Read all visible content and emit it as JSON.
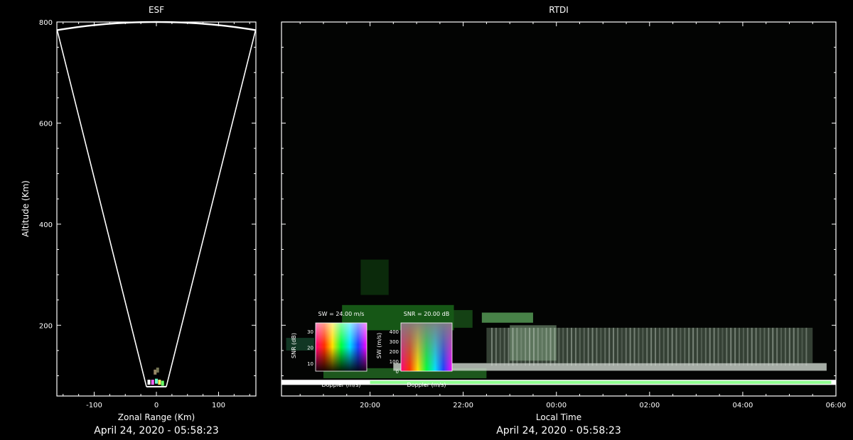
{
  "chart_data": [
    {
      "type": "scatter",
      "title": "ESF",
      "xlabel": "Zonal Range (Km)",
      "ylabel": "Altitude (Km)",
      "footer": "April 24, 2020 - 05:58:23",
      "xlim": [
        -160,
        160
      ],
      "ylim": [
        60,
        800
      ],
      "xticks": [
        -100,
        0,
        100
      ],
      "xtick_labels": [
        "-100",
        "0",
        "100"
      ],
      "yticks": [
        200,
        400,
        600,
        800
      ],
      "ytick_labels": [
        "200",
        "400",
        "600",
        "800"
      ],
      "sector": {
        "half_angle_deg": 11.5,
        "max_range_km": 800,
        "min_range_km": 80
      },
      "echoes": [
        {
          "x": -12,
          "y": 88,
          "color": "#ffffff"
        },
        {
          "x": -6,
          "y": 88,
          "color": "#ff66ff"
        },
        {
          "x": 0,
          "y": 90,
          "color": "#66ffcc"
        },
        {
          "x": 5,
          "y": 88,
          "color": "#ffff66"
        },
        {
          "x": 10,
          "y": 86,
          "color": "#66ff66"
        },
        {
          "x": -2,
          "y": 108,
          "color": "#998866"
        },
        {
          "x": 2,
          "y": 112,
          "color": "#777755"
        }
      ]
    },
    {
      "type": "heatmap",
      "title": "RTDI",
      "xlabel": "Local Time",
      "ylabel": "",
      "footer": "April 24, 2020 - 05:58:23",
      "xlim": [
        18.1,
        30.0
      ],
      "ylim": [
        60,
        800
      ],
      "xticks": [
        20,
        22,
        24,
        26,
        28,
        30
      ],
      "xtick_labels": [
        "20:00",
        "22:00",
        "00:00",
        "02:00",
        "04:00",
        "06:00"
      ],
      "yticks": [
        200,
        400,
        600,
        800
      ],
      "layers": [
        {
          "t0": 18.1,
          "t1": 30.0,
          "y0": 82,
          "y1": 92,
          "color": "#ffffff",
          "alpha": 1.0
        },
        {
          "t0": 20.0,
          "t1": 29.9,
          "y0": 84,
          "y1": 90,
          "color": "#44ff44",
          "alpha": 0.6
        },
        {
          "t0": 19.0,
          "t1": 22.5,
          "y0": 95,
          "y1": 115,
          "color": "#2a7a2a",
          "alpha": 0.7
        },
        {
          "t0": 20.5,
          "t1": 29.8,
          "y0": 110,
          "y1": 125,
          "color": "#cfd8cf",
          "alpha": 0.8
        },
        {
          "t0": 22.5,
          "t1": 29.5,
          "y0": 125,
          "y1": 195,
          "color": "#4a5a4a",
          "alpha": 0.7
        },
        {
          "t0": 23.0,
          "t1": 24.0,
          "y0": 130,
          "y1": 200,
          "color": "#7a9a7a",
          "alpha": 0.6
        },
        {
          "t0": 19.4,
          "t1": 21.8,
          "y0": 190,
          "y1": 240,
          "color": "#1f7a1f",
          "alpha": 0.7
        },
        {
          "t0": 21.8,
          "t1": 22.2,
          "y0": 195,
          "y1": 230,
          "color": "#1f6a1f",
          "alpha": 0.6
        },
        {
          "t0": 22.4,
          "t1": 23.5,
          "y0": 205,
          "y1": 225,
          "color": "#5aa35a",
          "alpha": 0.8
        },
        {
          "t0": 18.2,
          "t1": 18.8,
          "y0": 150,
          "y1": 175,
          "color": "#1a5a3a",
          "alpha": 0.6
        },
        {
          "t0": 19.8,
          "t1": 20.4,
          "y0": 260,
          "y1": 330,
          "color": "#114411",
          "alpha": 0.6
        }
      ],
      "insets": [
        {
          "title": "SW = 24.00 m/s",
          "xlabel": "Doppler (m/s)",
          "ylabel": "SNR (dB)",
          "yticks": [
            "30",
            "20",
            "10"
          ],
          "variant": "snr"
        },
        {
          "title": "SNR = 20.00 dB",
          "xlabel": "Doppler (m/s)",
          "ylabel": "SW (m/s)",
          "yticks": [
            "400",
            "300",
            "200",
            "100",
            "0"
          ],
          "variant": "sw"
        }
      ]
    }
  ]
}
